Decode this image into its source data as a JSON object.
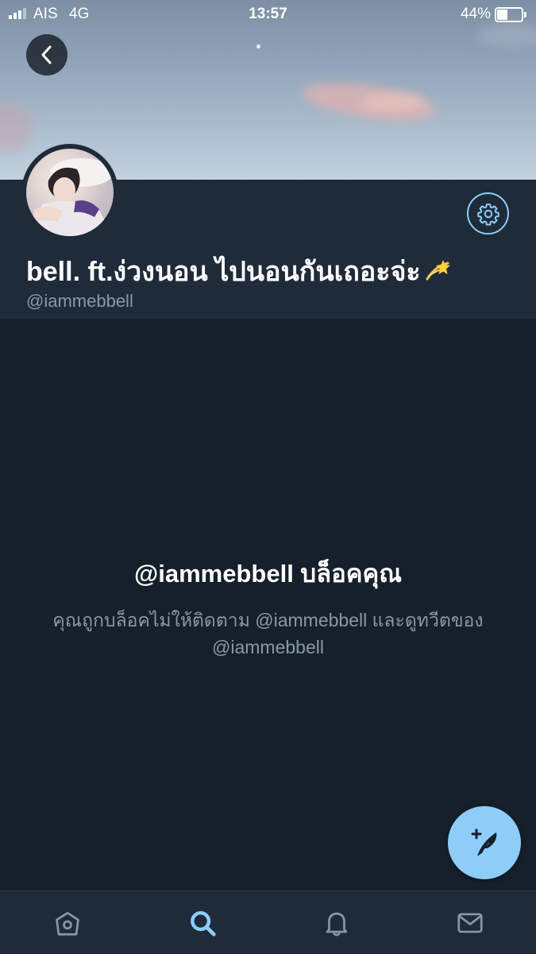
{
  "status_bar": {
    "carrier": "AIS",
    "network": "4G",
    "time": "13:57",
    "battery_percent": "44%",
    "battery_level": 0.44
  },
  "profile": {
    "display_name": "bell. ft.ง่วงนอน ไปนอนกันเถอะจ่ะ",
    "handle": "@iammebbell"
  },
  "blocked": {
    "title": "@iammebbell บล็อคคุณ",
    "message": "คุณถูกบล็อคไม่ให้ติดตาม @iammebbell และดูทวีตของ @iammebbell"
  },
  "tabs": [
    {
      "icon": "home-icon"
    },
    {
      "icon": "search-icon",
      "active": true
    },
    {
      "icon": "notifications-icon"
    },
    {
      "icon": "messages-icon"
    }
  ],
  "colors": {
    "background": "#15202b",
    "panel": "#202b3a",
    "accent": "#8ecdf8",
    "secondary_text": "#8899a6"
  }
}
